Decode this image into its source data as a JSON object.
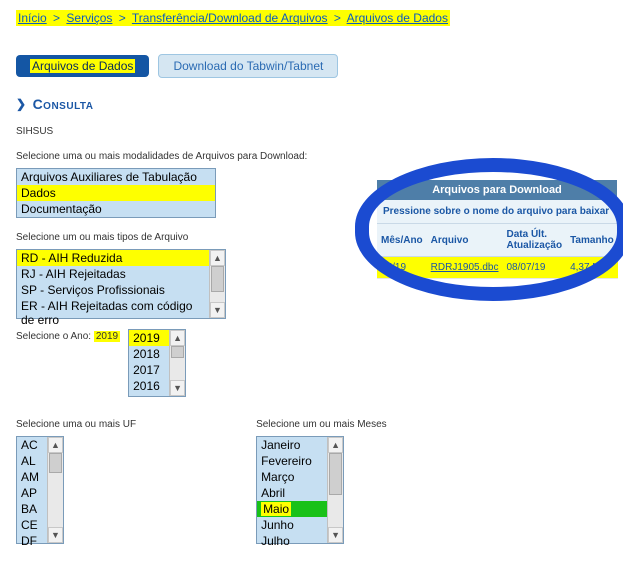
{
  "breadcrumb": {
    "items": [
      "Início",
      "Serviços",
      "Transferência/Download de Arquivos",
      "Arquivos de Dados"
    ],
    "sep": ">"
  },
  "tabs": {
    "active": "Arquivos de Dados",
    "inactive": "Download do Tabwin/Tabnet"
  },
  "consulta_title": "Consulta",
  "system_name": "SIHSUS",
  "labels": {
    "modalidade": "Selecione uma ou mais modalidades de Arquivos para Download:",
    "tipo": "Selecione um ou mais tipos de Arquivo",
    "ano": "Selecione o Ano:",
    "uf": "Selecione uma ou mais UF",
    "mes": "Selecione um ou mais Meses"
  },
  "modalidade": {
    "items": [
      "Arquivos Auxiliares de Tabulação",
      "Dados",
      "Documentação"
    ],
    "highlighted": 1
  },
  "tipo": {
    "items": [
      "RD - AIH Reduzida",
      "RJ - AIH Rejeitadas",
      "SP - Serviços Profissionais",
      "ER - AIH Rejeitadas com código de erro"
    ],
    "highlighted": 0
  },
  "ano": {
    "items": [
      "2019",
      "2018",
      "2017",
      "2016"
    ],
    "highlighted": 0
  },
  "uf": {
    "items": [
      "AC",
      "AL",
      "AM",
      "AP",
      "BA",
      "CE",
      "DF"
    ]
  },
  "mes": {
    "items": [
      "Janeiro",
      "Fevereiro",
      "Março",
      "Abril",
      "Maio",
      "Junho",
      "Julho"
    ],
    "highlighted": 4
  },
  "download": {
    "header": "Arquivos para Download",
    "hint": "Pressione sobre o nome do arquivo para baixar",
    "columns": [
      "Mês/Ano",
      "Arquivo",
      "Data Últ. Atualização",
      "Tamanho"
    ],
    "row": {
      "mes_ano": "05/19",
      "arquivo": "RDRJ1905.dbc",
      "data": "08/07/19",
      "tamanho": "4,37 MB"
    }
  }
}
